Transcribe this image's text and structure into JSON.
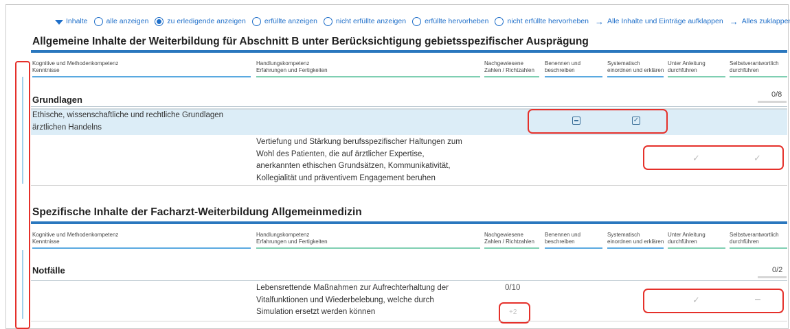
{
  "filters": {
    "inhalte_label": "Inhalte",
    "options": [
      "alle anzeigen",
      "zu erledigende anzeigen",
      "erfüllte anzeigen",
      "nicht erfüllte anzeigen",
      "erfüllte hervorheben",
      "nicht erfüllte hervorheben"
    ],
    "selected_index": 1,
    "expand_label": "Alle Inhalte und Einträge aufklappen",
    "collapse_label": "Alles zuklappen"
  },
  "columns": {
    "kognitive": [
      "Kognitive und Methodenkompetenz",
      "Kenntnisse"
    ],
    "handlung": [
      "Handlungskompetenz",
      "Erfahrungen und Fertigkeiten"
    ],
    "nachgewiesen": [
      "Nachgewiesene",
      "Zahlen / Richtzahlen"
    ],
    "benennen": [
      "Benennen und",
      "beschreiben"
    ],
    "systematisch": [
      "Systematisch",
      "einordnen und erklären"
    ],
    "anleitung": [
      "Unter Anleitung",
      "durchführen"
    ],
    "selbst": [
      "Selbstverantwortlich",
      "durchführen"
    ],
    "colors": {
      "blue": "#5aa9e0",
      "green": "#7fcfb2"
    }
  },
  "section1": {
    "title": "Allgemeine Inhalte der Weiterbildung für Abschnitt B unter Berücksichtigung gebietsspezifischer Ausprägung",
    "group_title": "Grundlagen",
    "group_count": "0/8",
    "row1_text": [
      "Ethische, wissenschaftliche und rechtliche Grundlagen",
      "ärztlichen Handelns"
    ],
    "row1_icons": [
      "minus-square-icon",
      "checked-square-icon"
    ],
    "row2_text": [
      "Vertiefung und Stärkung berufsspezifischer Haltungen zum",
      "Wohl des Patienten, die auf ärztlicher Expertise,",
      "anerkannten ethischen Grundsätzen, Kommunikativität,",
      "Kollegialität und präventivem Engagement beruhen"
    ]
  },
  "section2": {
    "title": "Spezifische Inhalte der Facharzt-Weiterbildung Allgemeinmedizin",
    "group_title": "Notfälle",
    "group_count": "0/2",
    "row_text": [
      "Lebensrettende Maßnahmen zur Aufrechterhaltung der",
      "Vitalfunktionen und Wiederbelebung, welche durch",
      "Simulation ersetzt werden können"
    ],
    "row_number": "0/10",
    "row_plus": "+2"
  },
  "annotation_color": "#e5302a",
  "accent_color": "#2a77be"
}
